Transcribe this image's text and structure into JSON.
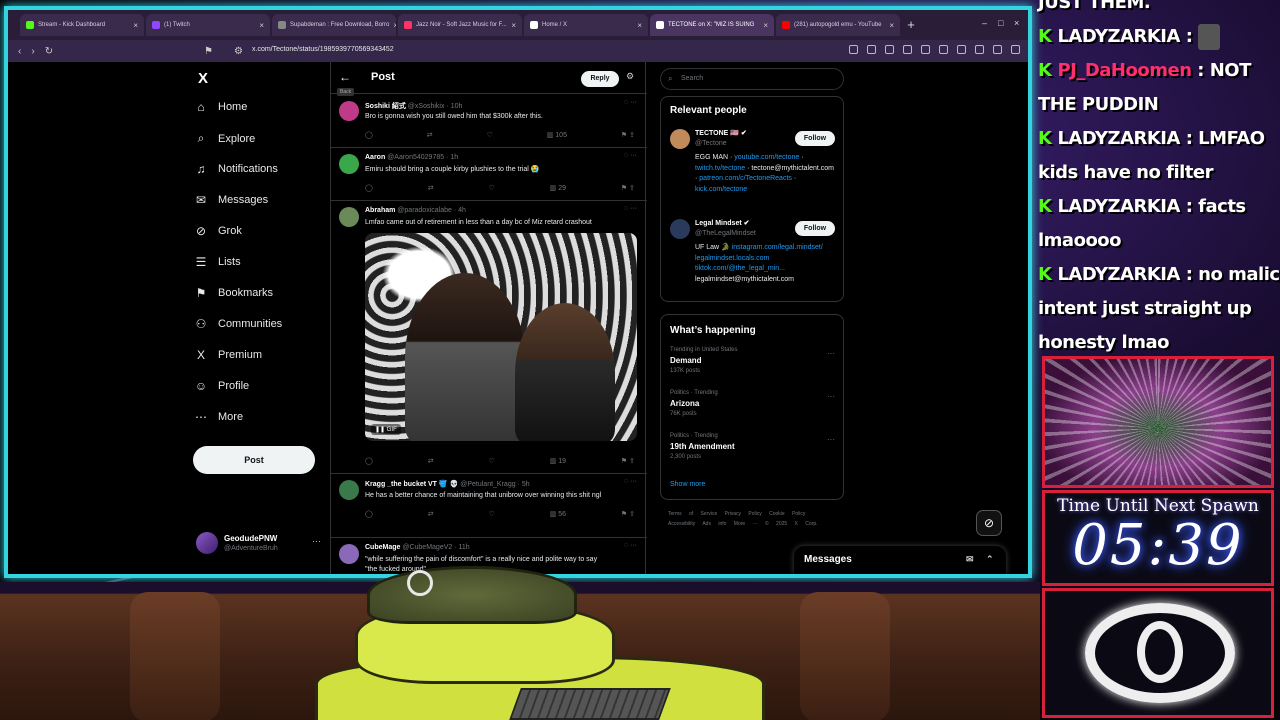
{
  "browser": {
    "tabs": [
      {
        "label": "Stream - Kick Dashboard",
        "color": "#53fc18",
        "active": false
      },
      {
        "label": "(1) Twitch",
        "color": "#9146ff",
        "active": false
      },
      {
        "label": "Supabdeman : Free Download, Borro",
        "color": "#888888",
        "active": false
      },
      {
        "label": "Jazz Noir - Soft Jazz Music for F...",
        "color": "#ff3366",
        "active": false
      },
      {
        "label": "Home / X",
        "color": "#ffffff",
        "active": false
      },
      {
        "label": "TECTONE on X: \"MIZ IS SUING",
        "color": "#ffffff",
        "active": true
      },
      {
        "label": "(281) autopogold emu - YouTube",
        "color": "#ff0000",
        "active": false
      }
    ],
    "new_tab": "+",
    "url": "x.com/Tectone/status/1985939770569343452"
  },
  "nav": {
    "logo": "X",
    "items": [
      {
        "icon": "home-icon",
        "glyph": "⌂",
        "label": "Home"
      },
      {
        "icon": "explore-icon",
        "glyph": "⌕",
        "label": "Explore"
      },
      {
        "icon": "bell-icon",
        "glyph": "♫",
        "label": "Notifications"
      },
      {
        "icon": "mail-icon",
        "glyph": "✉",
        "label": "Messages"
      },
      {
        "icon": "grok-icon",
        "glyph": "⊘",
        "label": "Grok"
      },
      {
        "icon": "list-icon",
        "glyph": "☰",
        "label": "Lists"
      },
      {
        "icon": "bookmark-icon",
        "glyph": "⚑",
        "label": "Bookmarks"
      },
      {
        "icon": "communities-icon",
        "glyph": "⚇",
        "label": "Communities"
      },
      {
        "icon": "premium-icon",
        "glyph": "X",
        "label": "Premium"
      },
      {
        "icon": "profile-icon",
        "glyph": "☺",
        "label": "Profile"
      },
      {
        "icon": "more-icon",
        "glyph": "⋯",
        "label": "More"
      }
    ],
    "post_button": "Post",
    "account": {
      "name": "GeodudePNW",
      "handle": "@AdventureBruh",
      "menu": "···"
    }
  },
  "main": {
    "back_tooltip": "Back",
    "title": "Post",
    "reply_button": "Reply",
    "tweets": [
      {
        "name": "Soshiki 紹式",
        "handle": "@xSoshikix · 10h",
        "text": "Bro is gonna wish you still owed him that $300k after this.",
        "likes": "",
        "views": "105",
        "avatar": "#c03a8a"
      },
      {
        "name": "Aaron",
        "handle": "@Aaron54029785 · 1h",
        "text": "Emiru should bring a couple kirby plushies to the trial 😭",
        "likes": "",
        "views": "29",
        "avatar": "#3aa84a"
      },
      {
        "name": "Abraham",
        "handle": "@paradoxicalabe · 4h",
        "text": "Lmfao came out of retirement in less than a day bc of Miz retard crashout",
        "likes": "",
        "views": "19",
        "avatar": "#6a8a5a",
        "gif": "GIF"
      },
      {
        "name": "Kragg _the bucket VT 🪣 💀",
        "handle": "@Petulant_Kragg · 5h",
        "text": "He has a better chance of maintaining that unibrow over winning this shit ngl",
        "likes": "",
        "views": "56",
        "avatar": "#3a7a4a"
      },
      {
        "name": "CubeMage",
        "handle": "@CubeMageV2 · 11h",
        "text": "\"while suffering the pain of discomfort\" is a really nice and polite way to say \"the fucked around\"",
        "avatar": "#8a6ab8"
      }
    ]
  },
  "right": {
    "search_placeholder": "Search",
    "relevant_title": "Relevant people",
    "people": [
      {
        "name": "TECTONE 🇺🇸 ✔",
        "handle": "@Tectone",
        "follow": "Follow",
        "bio": [
          "EGG MAN · ",
          "youtube.com/tectone",
          " · ",
          "twitch.tv/tectone",
          " · tectone@mythictalent.com · ",
          "patreon.com/c/TectoneReacts",
          " · ",
          "kick.com/tectone"
        ],
        "avatar": "#c08a5a"
      },
      {
        "name": "Legal Mindset ✔",
        "handle": "@TheLegalMindset",
        "follow": "Follow",
        "bio": [
          "UF Law 🐊 ",
          "instagram.com/legal.mindset/",
          " ",
          "legalmindset.locals.com",
          " ",
          "tiktok.com/@the_legal_min...",
          " legalmindset@mythictalent.com"
        ],
        "avatar": "#2a3a5a"
      }
    ],
    "happening_title": "What’s happening",
    "trends": [
      {
        "category": "Trending in United States",
        "title": "Demand",
        "count": "137K posts"
      },
      {
        "category": "Politics · Trending",
        "title": "Arizona",
        "count": "76K posts"
      },
      {
        "category": "Politics · Trending",
        "title": "19th Amendment",
        "count": "2,300 posts"
      }
    ],
    "show_more": "Show more",
    "footer": "Terms of Service  Privacy Policy  Cookie Policy  Accessibility  Ads info  More ···  © 2025 X Corp.",
    "messages_drawer": "Messages"
  },
  "chat": {
    "lines": [
      {
        "user": "JUST THEM.",
        "text": "",
        "emote": false,
        "partial": true
      },
      {
        "user": "LADYZARKIA",
        "text": " : ",
        "emote": true
      },
      {
        "user": "PJ_DaHoomen",
        "text": " : NOT THE PUDDIN",
        "emote": false,
        "alt": true
      },
      {
        "user": "LADYZARKIA",
        "text": " : LMFAO kids have no filter",
        "emote": false
      },
      {
        "user": "LADYZARKIA",
        "text": " : facts lmaoooo",
        "emote": false
      },
      {
        "user": "LADYZARKIA",
        "text": " : no malic intent just straight up honesty lmao",
        "emote": false
      },
      {
        "user": "LADYZARKIA",
        "text": " : ",
        "emote": true
      }
    ]
  },
  "overlay": {
    "timer_label": "Time Until Next Spawn",
    "timer_value": "05:39"
  }
}
